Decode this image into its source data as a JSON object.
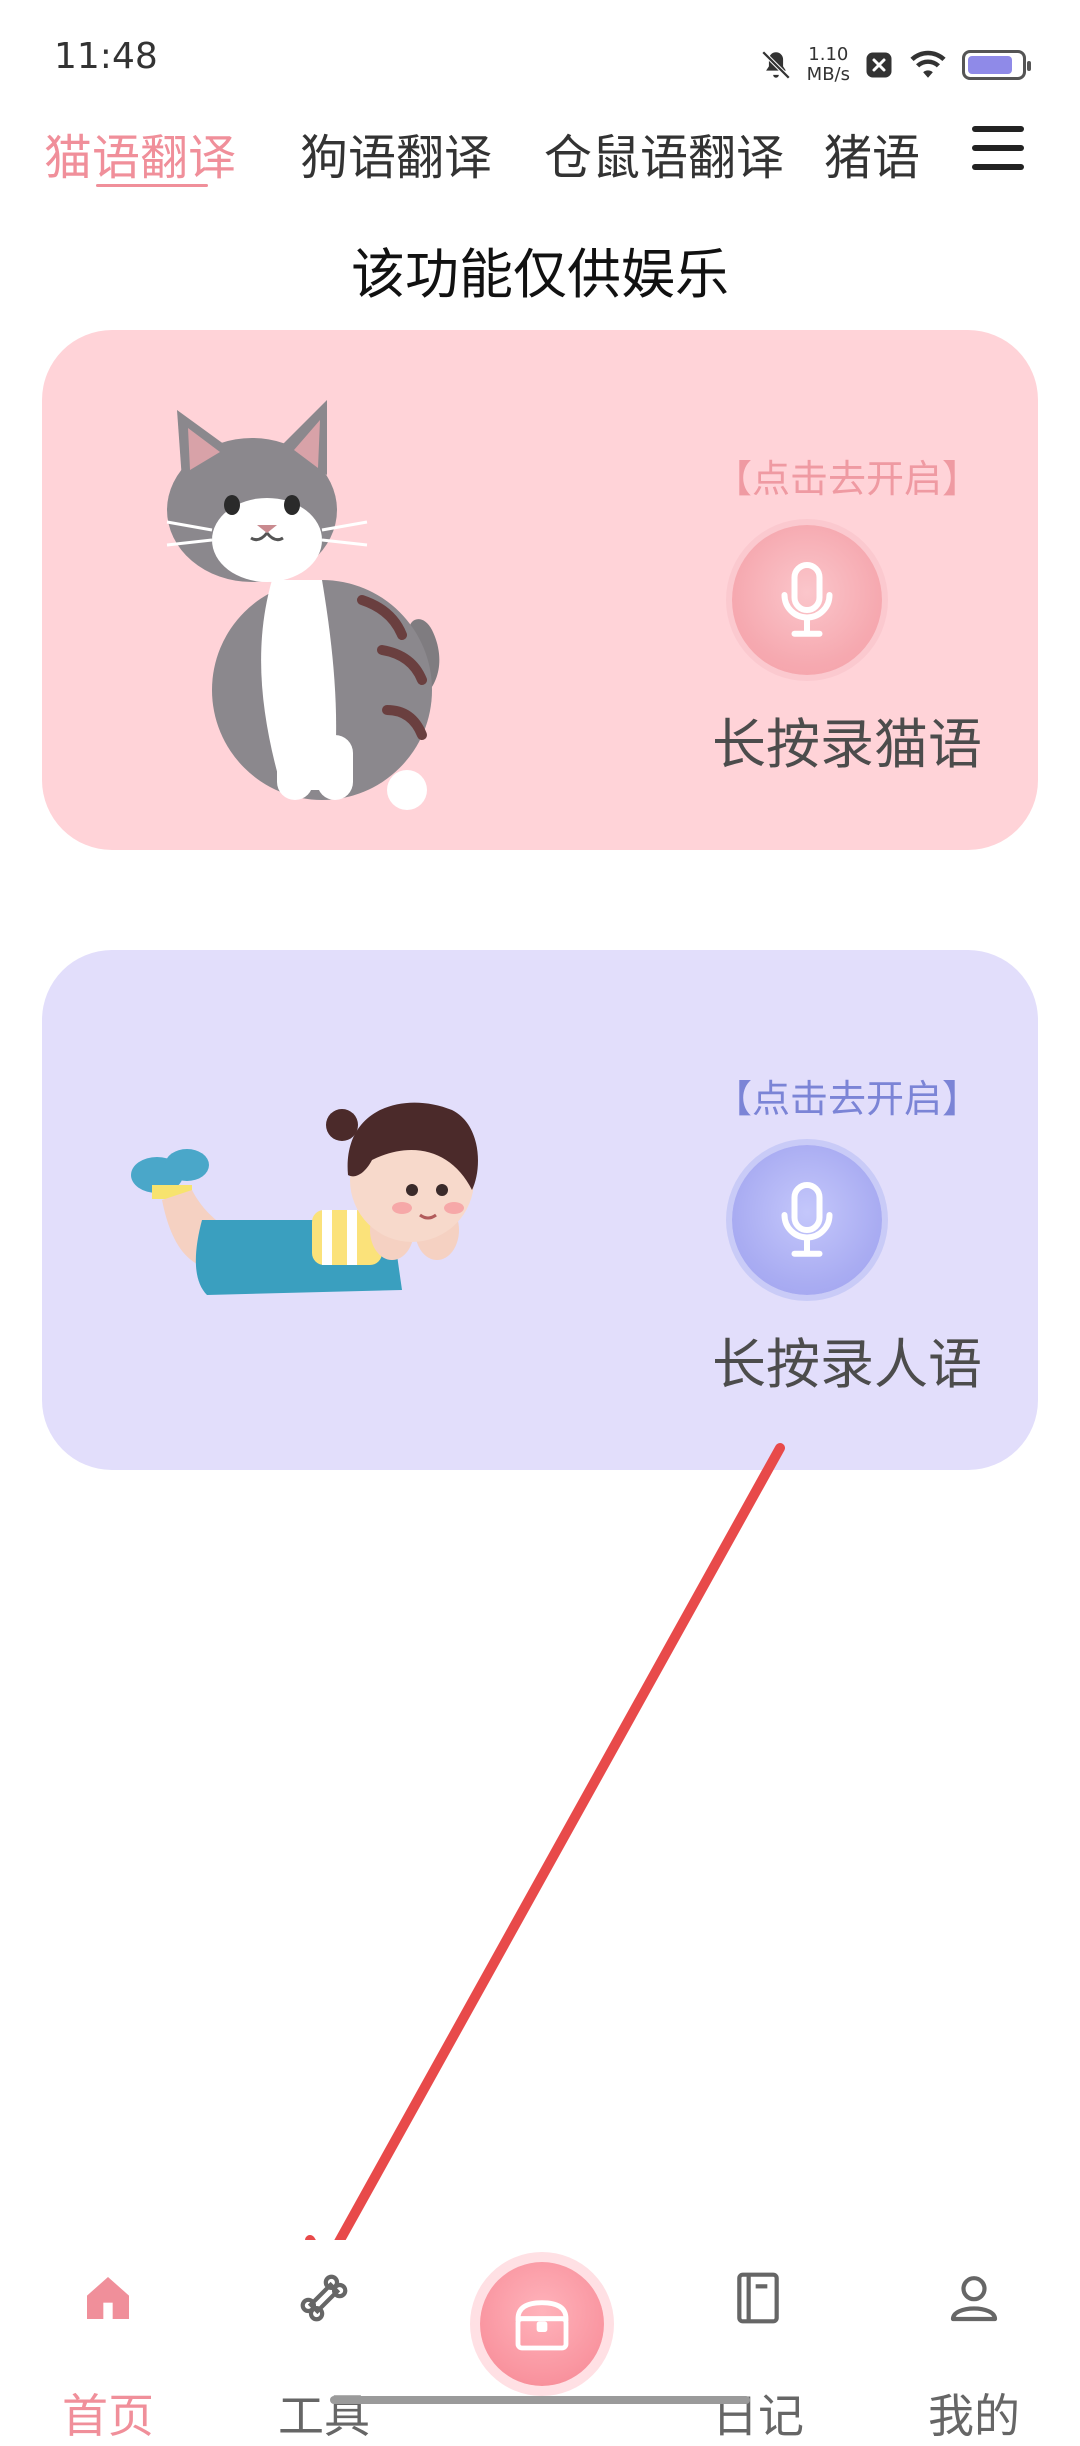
{
  "status_bar": {
    "time": "11:48",
    "net_speed_value": "1.10",
    "net_speed_unit": "MB/s",
    "icons": [
      "mute-bell-icon",
      "notification-x-icon",
      "wifi-icon",
      "battery-icon"
    ]
  },
  "tabs": [
    {
      "label": "猫语翻译",
      "active": true
    },
    {
      "label": "狗语翻译",
      "active": false
    },
    {
      "label": "仓鼠语翻译",
      "active": false
    },
    {
      "label": "猪语",
      "active": false
    }
  ],
  "menu_icon": "hamburger-menu-icon",
  "notice": "该功能仅供娱乐",
  "cards": {
    "cat": {
      "hint": "【点击去开启】",
      "action": "长按录猫语",
      "icon": "microphone-icon",
      "color": "#ffd3d8"
    },
    "human": {
      "hint": "【点击去开启】",
      "action": "长按录人语",
      "icon": "microphone-icon",
      "color": "#e2defb"
    }
  },
  "bottom_nav": {
    "items": [
      {
        "label": "首页",
        "icon": "home-icon",
        "active": true
      },
      {
        "label": "工具",
        "icon": "bone-icon",
        "active": false
      },
      {
        "label": "日记",
        "icon": "diary-icon",
        "active": false
      },
      {
        "label": "我的",
        "icon": "person-icon",
        "active": false
      }
    ],
    "center_icon": "treasure-chest-icon"
  },
  "annotation": {
    "type": "red-arrow",
    "color": "#e84a4a"
  },
  "colors": {
    "accent": "#f08f9a",
    "human_accent": "#7b84d6"
  }
}
